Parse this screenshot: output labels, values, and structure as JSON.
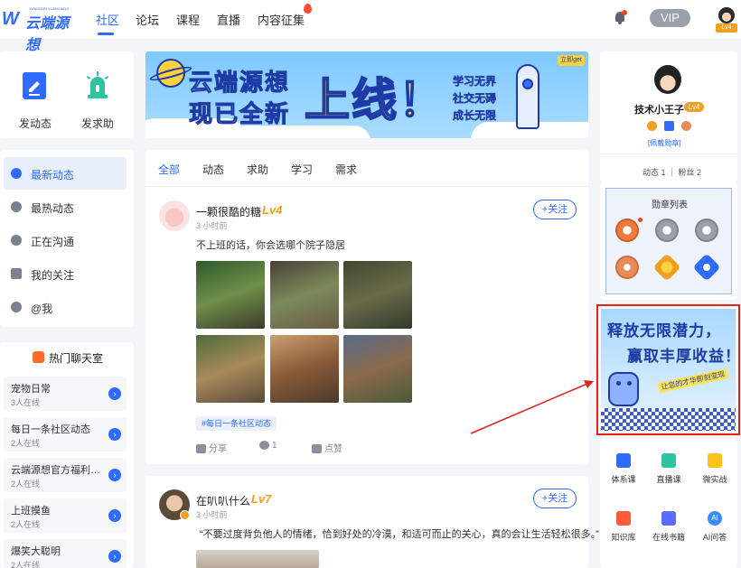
{
  "header": {
    "logo_text": "云端源想",
    "logo_mark": "W",
    "logo_tiny": "YUNDUAN YUANXIANG",
    "nav": [
      "社区",
      "论坛",
      "课程",
      "直播",
      "内容征集"
    ],
    "vip": "VIP",
    "avatar_level": "Lv4"
  },
  "quick_actions": [
    "发动态",
    "发求助"
  ],
  "menu": [
    "最新动态",
    "最热动态",
    "正在沟通",
    "我的关注",
    "@我"
  ],
  "chat_rooms": {
    "title": "热门聊天室",
    "rooms": [
      {
        "name": "宠物日常",
        "count": "3人在线"
      },
      {
        "name": "每日一条社区动态",
        "count": "2人在线"
      },
      {
        "name": "云端源想官方福利活动",
        "count": "2人在线"
      },
      {
        "name": "上班摸鱼",
        "count": "2人在线"
      },
      {
        "name": "爆笑大聪明",
        "count": "2人在线"
      }
    ],
    "go": "›"
  },
  "banner": {
    "line1": "云端源想",
    "line2": "现已全新",
    "big": "上线！",
    "side": [
      "学习无界",
      "社交无碍",
      "成长无限"
    ],
    "tag": "立即get"
  },
  "tabs": [
    "全部",
    "动态",
    "求助",
    "学习",
    "需求"
  ],
  "posts": [
    {
      "name": "一颗很酷的糖",
      "level": "Lv4",
      "time": "3 小时前",
      "follow": "+关注",
      "text": "不上班的话，你会选哪个院子隐居",
      "hashtag": "#每日一条社区动态",
      "actions": {
        "share": "分享",
        "comment": "1",
        "like": "点赞"
      }
    },
    {
      "name": "在叭叭什么",
      "level": "Lv7",
      "time": "3 小时前",
      "follow": "+关注",
      "text": "“不要过度背负他人的情绪，恰到好处的冷漠，和适可而止的关心，真的会让生活轻松很多。”"
    }
  ],
  "profile": {
    "name": "技术小王子",
    "level": "Lv4",
    "badge_link": "[佩戴勋章]",
    "stats": "动态 1 ｜ 粉丝 2",
    "medal_title": "勋章列表"
  },
  "promo": {
    "line1": "释放无限潜力，",
    "line2": "赢取丰厚收益！",
    "sub": "让您的才华即刻变现"
  },
  "tools": [
    "体系课",
    "直播课",
    "微实战",
    "知识库",
    "在线书籍",
    "AI问答"
  ],
  "colors": {
    "accent": "#2f6bff",
    "level": "#f0a020",
    "highlight": "#e2231a"
  }
}
